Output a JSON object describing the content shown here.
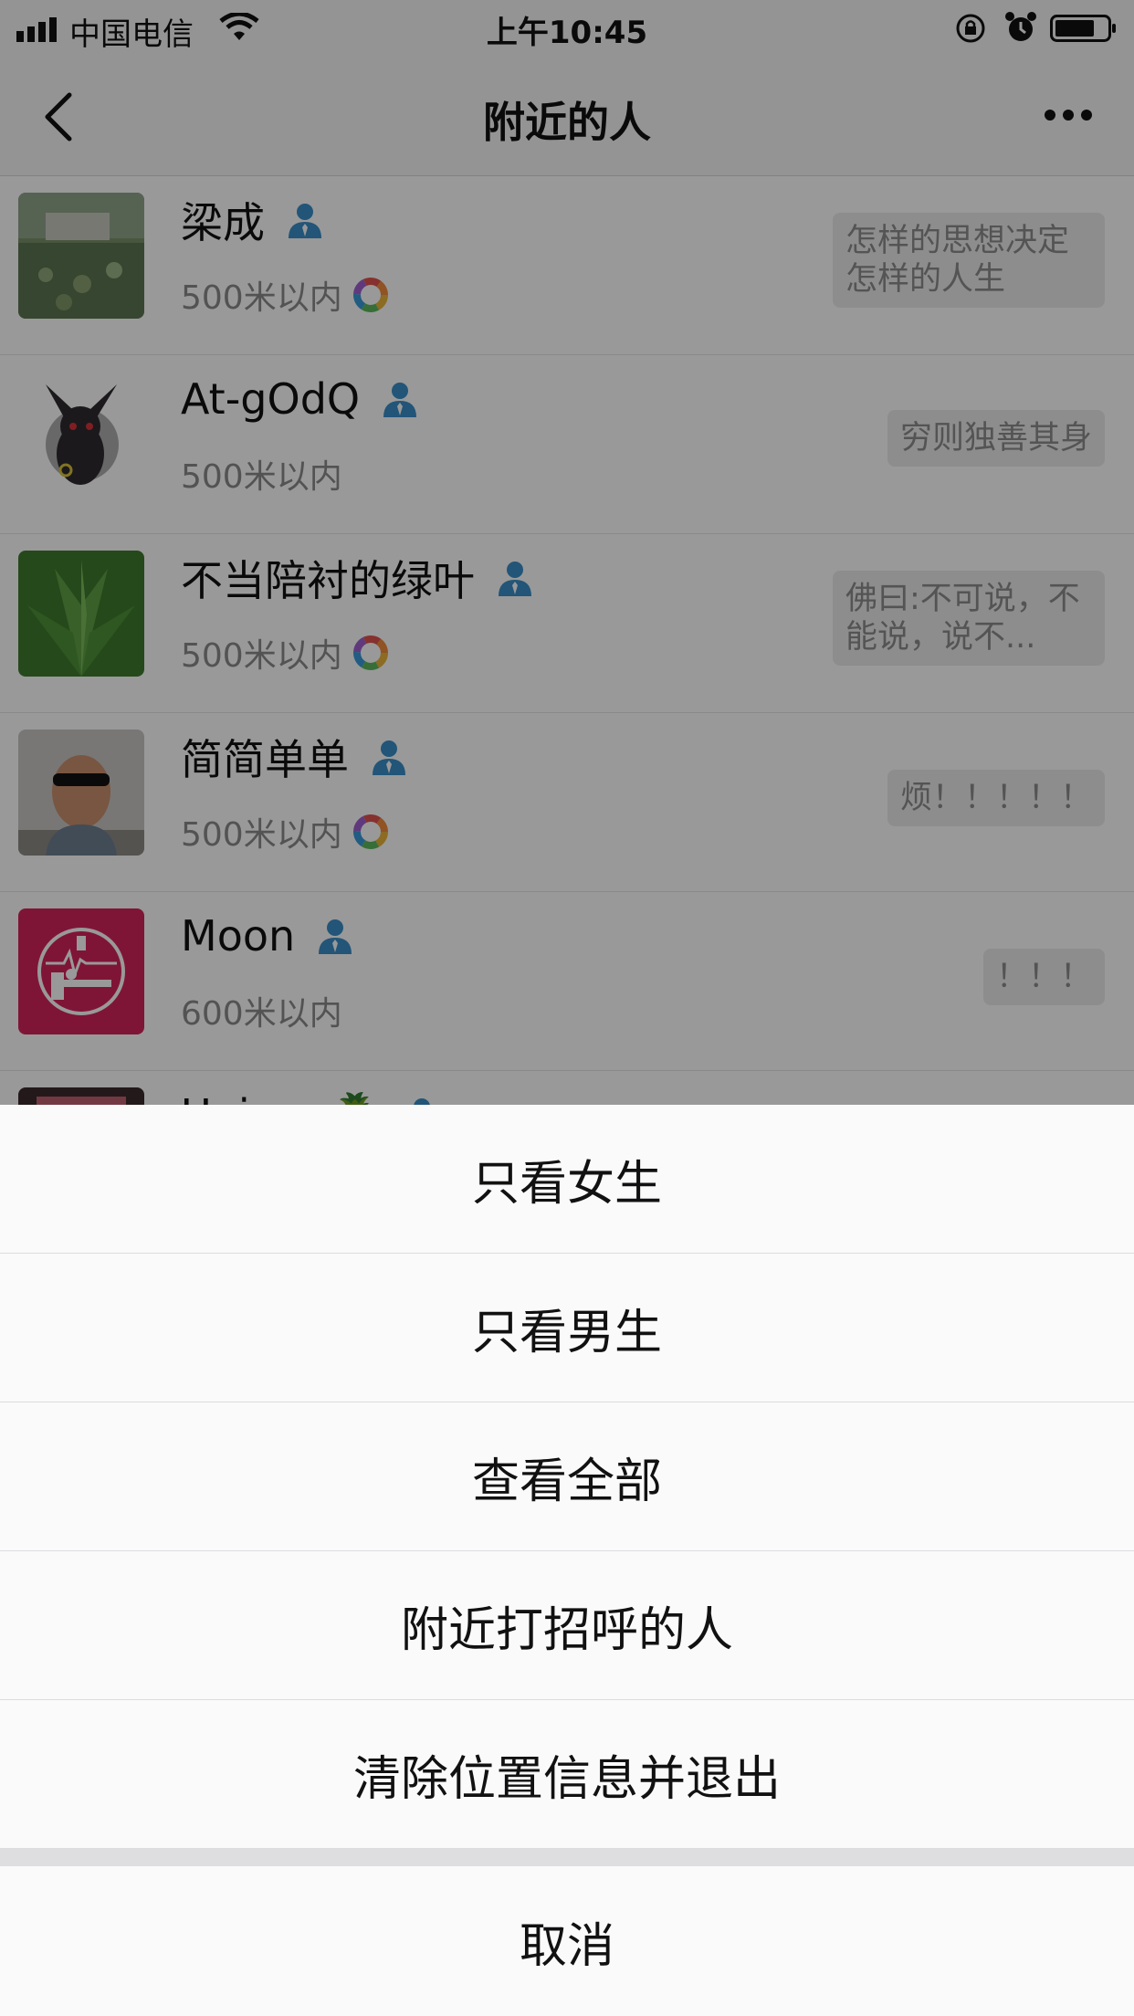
{
  "status_bar": {
    "carrier": "中国电信",
    "time": "上午10:45"
  },
  "nav": {
    "title": "附近的人"
  },
  "people": [
    {
      "name": "梁成",
      "distance": "500米以内",
      "signature": "怎样的思想决定怎样的人生",
      "has_ring": true
    },
    {
      "name": "At-gOdQ",
      "distance": "500米以内",
      "signature": "穷则独善其身",
      "has_ring": false
    },
    {
      "name": "不当陪衬的绿叶",
      "distance": "500米以内",
      "signature": "佛曰:不可说，不能说，说不...",
      "has_ring": true
    },
    {
      "name": "简简单单",
      "distance": "500米以内",
      "signature": "烦！！！！！",
      "has_ring": true
    },
    {
      "name": "Moon",
      "distance": "600米以内",
      "signature": "！！！",
      "has_ring": false
    },
    {
      "name": "Unique🍍",
      "distance": "",
      "signature": "",
      "has_ring": false
    }
  ],
  "action_sheet": {
    "options": [
      "只看女生",
      "只看男生",
      "查看全部",
      "附近打招呼的人",
      "清除位置信息并退出"
    ],
    "cancel": "取消"
  },
  "colors": {
    "person_icon": "#3a8ec8",
    "avatar_moon": "#d4245b"
  }
}
